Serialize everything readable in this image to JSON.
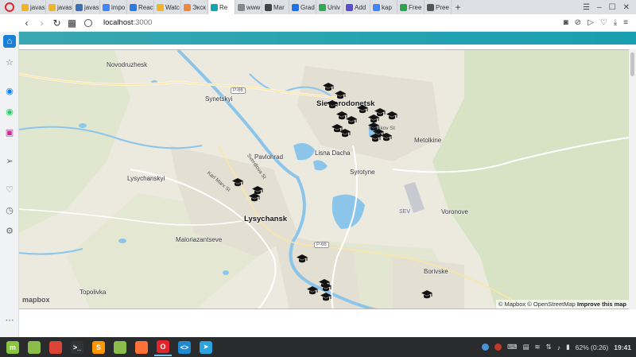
{
  "browser": {
    "tabs": [
      {
        "label": "javas",
        "color": "#f0b429"
      },
      {
        "label": "javas",
        "color": "#f0b429"
      },
      {
        "label": "javas",
        "color": "#3b6fb6"
      },
      {
        "label": "impo",
        "color": "#4285f4"
      },
      {
        "label": "Reac",
        "color": "#2c7be5"
      },
      {
        "label": "Watc",
        "color": "#f0b429"
      },
      {
        "label": "Экск",
        "color": "#e98b3a"
      },
      {
        "label": "Re",
        "color": "#13a4b4",
        "active": true
      },
      {
        "label": "www",
        "color": "#888888"
      },
      {
        "label": "Mar",
        "color": "#444444"
      },
      {
        "label": "Grad",
        "color": "#1a73e8"
      },
      {
        "label": "Univ",
        "color": "#34a853"
      },
      {
        "label": "Add",
        "color": "#5a4fcf"
      },
      {
        "label": "kap",
        "color": "#4285f4"
      },
      {
        "label": "Free",
        "color": "#2da44e"
      },
      {
        "label": "Pree",
        "color": "#555555"
      }
    ],
    "tab_add_label": "+",
    "url_host": "localhost",
    "url_port": ":3000"
  },
  "map": {
    "places": [
      {
        "name": "Novodruzhesk",
        "big": false
      },
      {
        "name": "Synetskyi",
        "big": false
      },
      {
        "name": "Sievierodonetsk",
        "big": true
      },
      {
        "name": "Metolkine",
        "big": false
      },
      {
        "name": "Pavlohrad",
        "big": false
      },
      {
        "name": "Lisna Dacha",
        "big": false
      },
      {
        "name": "Syrotyne",
        "big": false
      },
      {
        "name": "Lysychanskyi",
        "big": false
      },
      {
        "name": "Lysychansk",
        "big": true
      },
      {
        "name": "Voronove",
        "big": false
      },
      {
        "name": "Maloriazantseve",
        "big": false
      },
      {
        "name": "Borivske",
        "big": false
      },
      {
        "name": "Topolivka",
        "big": false
      }
    ],
    "roads": [
      "P-66",
      "P-66"
    ],
    "streets": [
      "Sverdlova St",
      "Karl Marx St",
      "Havlikov St"
    ],
    "airport_label": "SEV",
    "logo": "mapbox",
    "attribution": {
      "mapbox": "© Mapbox",
      "osm": "© OpenStreetMap",
      "improve": "Improve this map"
    },
    "marker_icon": "graduation-cap-icon",
    "marker_count": 24
  },
  "taskbar": {
    "apps": [
      {
        "name": "mint-menu",
        "color": "#87c540",
        "glyph": "m"
      },
      {
        "name": "files",
        "color": "#8bbd4b",
        "glyph": ""
      },
      {
        "name": "chrome",
        "color": "#db4437",
        "glyph": ""
      },
      {
        "name": "terminal",
        "color": "#333333",
        "glyph": ">_"
      },
      {
        "name": "sublime",
        "color": "#ff9800",
        "glyph": "S"
      },
      {
        "name": "files2",
        "color": "#8bbd4b",
        "glyph": ""
      },
      {
        "name": "firefox",
        "color": "#ff7139",
        "glyph": ""
      },
      {
        "name": "opera",
        "color": "#e2252c",
        "glyph": "O"
      },
      {
        "name": "vscode",
        "color": "#1f8ad2",
        "glyph": "<>"
      },
      {
        "name": "telegram",
        "color": "#2aa3df",
        "glyph": "➤"
      }
    ],
    "battery": "62% (0:26)",
    "clock": "19:41"
  }
}
